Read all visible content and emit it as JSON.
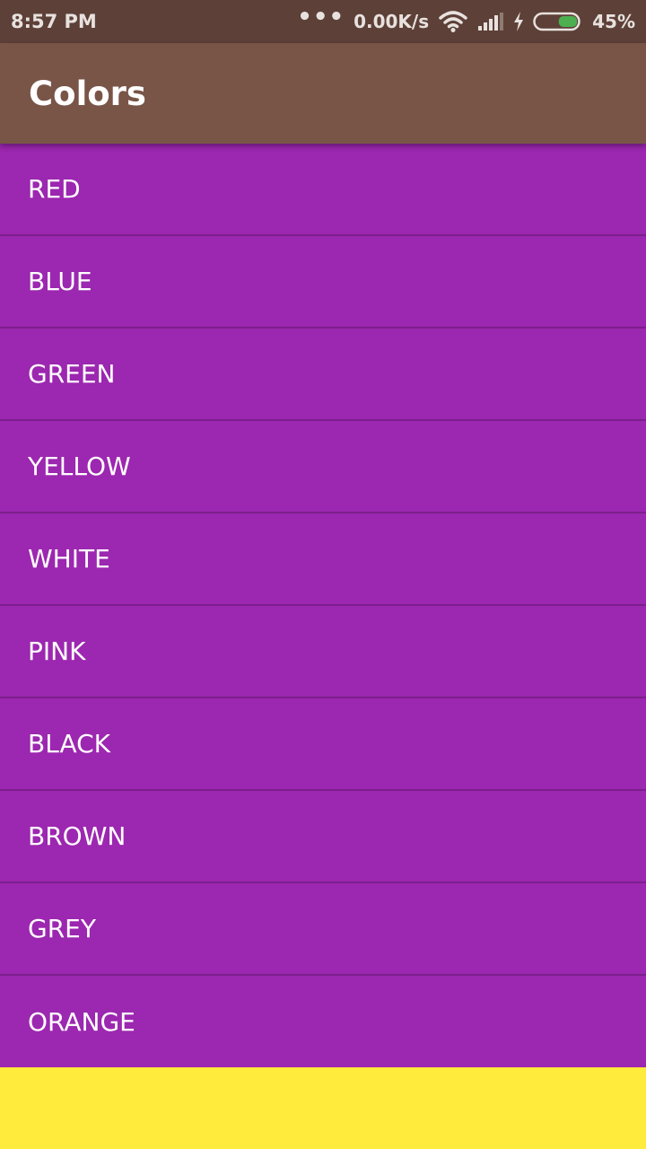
{
  "status_bar": {
    "time": "8:57 PM",
    "dots": "•••",
    "network_speed": "0.00K/s",
    "battery_percent": "45%",
    "battery_level": 0.45,
    "icons": [
      "more-dots-icon",
      "wifi-icon",
      "signal-icon",
      "charging-bolt-icon",
      "battery-icon"
    ]
  },
  "app_bar": {
    "title": "Colors"
  },
  "colors_list": {
    "items": [
      {
        "label": "RED"
      },
      {
        "label": "BLUE"
      },
      {
        "label": "GREEN"
      },
      {
        "label": "YELLOW"
      },
      {
        "label": "WHITE"
      },
      {
        "label": "PINK"
      },
      {
        "label": "BLACK"
      },
      {
        "label": "BROWN"
      },
      {
        "label": "GREY"
      },
      {
        "label": "ORANGE"
      }
    ]
  },
  "theme": {
    "status_bar_color": "#5D4037",
    "app_bar_color": "#795548",
    "list_item_color": "#9C27B0",
    "divider_color": "#7B1F8C",
    "background_color": "#FFEB3B",
    "battery_fill_color": "#4CAF50"
  }
}
